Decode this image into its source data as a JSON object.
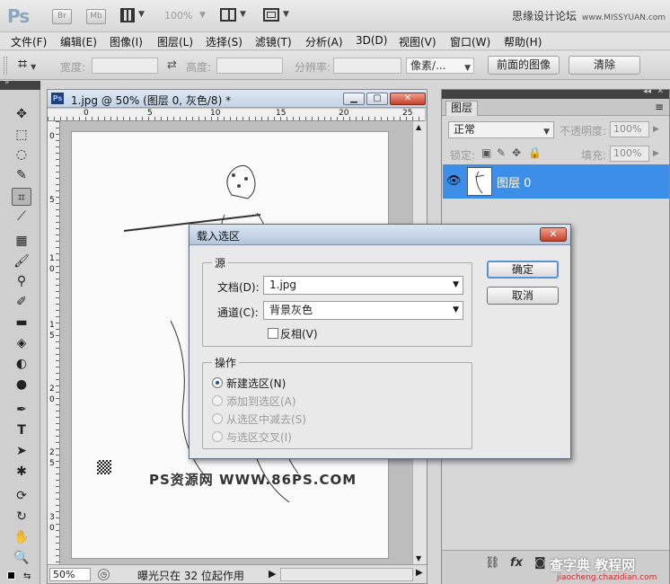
{
  "app": {
    "logo": "Ps",
    "bridge_label": "Br",
    "minibridge_label": "Mb",
    "zoom": "100%",
    "brand_text": "思缘设计论坛",
    "brand_url": "www.MISSYUAN.com"
  },
  "menu": {
    "items": [
      "文件(F)",
      "编辑(E)",
      "图像(I)",
      "图层(L)",
      "选择(S)",
      "滤镜(T)",
      "分析(A)",
      "3D(D)",
      "视图(V)",
      "窗口(W)",
      "帮助(H)"
    ]
  },
  "options": {
    "width_label": "宽度:",
    "height_label": "高度:",
    "resolution_label": "分辨率:",
    "unit_value": "像素/...",
    "front_image_label": "前面的图像",
    "clear_label": "清除"
  },
  "document": {
    "title": "1.jpg @ 50% (图层 0, 灰色/8) *",
    "ruler_h": [
      "0",
      "5",
      "10",
      "15",
      "20",
      "25"
    ],
    "ruler_v": [
      "0",
      "5",
      "1",
      "0",
      "1",
      "5",
      "2",
      "0",
      "2",
      "5",
      "3",
      "0"
    ],
    "watermark": "PS资源网 WWW.86PS.COM",
    "zoom_value": "50%",
    "status_text": "曝光只在 32 位起作用"
  },
  "layers_panel": {
    "tab": "图层",
    "blend_mode": "正常",
    "opacity_label": "不透明度:",
    "opacity_value": "100%",
    "lock_label": "锁定:",
    "fill_label": "填充:",
    "fill_value": "100%",
    "layer_name": "图层 0"
  },
  "dialog": {
    "title": "载入选区",
    "source_group": "源",
    "document_label": "文档(D):",
    "document_value": "1.jpg",
    "channel_label": "通道(C):",
    "channel_value": "背景灰色",
    "invert_label": "反相(V)",
    "invert_checked": false,
    "operation_group": "操作",
    "operations": [
      {
        "label": "新建选区(N)",
        "checked": true,
        "enabled": true
      },
      {
        "label": "添加到选区(A)",
        "checked": false,
        "enabled": false
      },
      {
        "label": "从选区中减去(S)",
        "checked": false,
        "enabled": false
      },
      {
        "label": "与选区交叉(I)",
        "checked": false,
        "enabled": false
      }
    ],
    "ok_label": "确定",
    "cancel_label": "取消"
  },
  "overlay_watermark": {
    "text": "查字典 教程网",
    "url": "jiaocheng.chazidian.com"
  },
  "colors": {
    "layer_selected": "#3d8ee8",
    "title_bar": "#c4d3e5",
    "close_red": "#c6412b"
  }
}
